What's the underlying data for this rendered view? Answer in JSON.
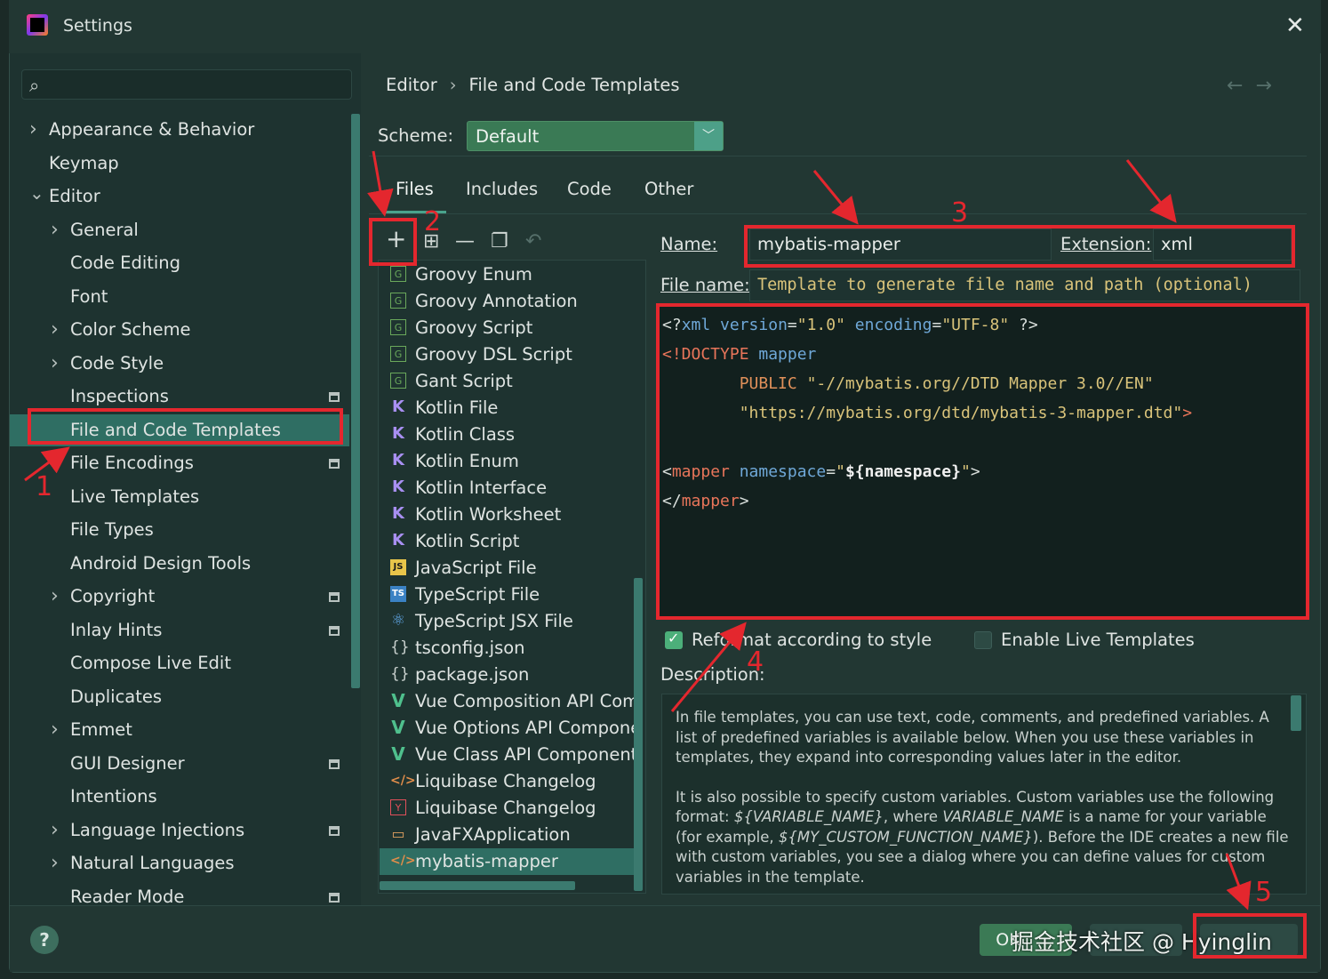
{
  "window": {
    "title": "Settings"
  },
  "search": {
    "placeholder": ""
  },
  "sidebar": {
    "items": [
      {
        "label": "Appearance & Behavior",
        "chev": ">",
        "level": 0
      },
      {
        "label": "Keymap",
        "chev": "",
        "level": 0
      },
      {
        "label": "Editor",
        "chev": "v",
        "level": 0
      },
      {
        "label": "General",
        "chev": ">",
        "level": 1
      },
      {
        "label": "Code Editing",
        "chev": "",
        "level": 1
      },
      {
        "label": "Font",
        "chev": "",
        "level": 1
      },
      {
        "label": "Color Scheme",
        "chev": ">",
        "level": 1
      },
      {
        "label": "Code Style",
        "chev": ">",
        "level": 1
      },
      {
        "label": "Inspections",
        "chev": "",
        "level": 1,
        "pin": true
      },
      {
        "label": "File and Code Templates",
        "chev": "",
        "level": 1,
        "selected": true
      },
      {
        "label": "File Encodings",
        "chev": "",
        "level": 1,
        "pin": true
      },
      {
        "label": "Live Templates",
        "chev": "",
        "level": 1
      },
      {
        "label": "File Types",
        "chev": "",
        "level": 1
      },
      {
        "label": "Android Design Tools",
        "chev": "",
        "level": 1
      },
      {
        "label": "Copyright",
        "chev": ">",
        "level": 1,
        "pin": true
      },
      {
        "label": "Inlay Hints",
        "chev": "",
        "level": 1,
        "pin": true
      },
      {
        "label": "Compose Live Edit",
        "chev": "",
        "level": 1
      },
      {
        "label": "Duplicates",
        "chev": "",
        "level": 1
      },
      {
        "label": "Emmet",
        "chev": ">",
        "level": 1
      },
      {
        "label": "GUI Designer",
        "chev": "",
        "level": 1,
        "pin": true
      },
      {
        "label": "Intentions",
        "chev": "",
        "level": 1
      },
      {
        "label": "Language Injections",
        "chev": ">",
        "level": 1,
        "pin": true
      },
      {
        "label": "Natural Languages",
        "chev": ">",
        "level": 1
      },
      {
        "label": "Reader Mode",
        "chev": "",
        "level": 1,
        "pin": true
      }
    ]
  },
  "breadcrumb": {
    "parent": "Editor",
    "current": "File and Code Templates"
  },
  "scheme": {
    "label": "Scheme:",
    "value": "Default"
  },
  "tabs": [
    "Files",
    "Includes",
    "Code",
    "Other"
  ],
  "templates": [
    {
      "label": "Groovy Enum",
      "icon": "groovy-icon",
      "glyph": "G",
      "cls": "g"
    },
    {
      "label": "Groovy Annotation",
      "icon": "groovy-icon",
      "glyph": "G",
      "cls": "g"
    },
    {
      "label": "Groovy Script",
      "icon": "groovy-icon",
      "glyph": "G",
      "cls": "g"
    },
    {
      "label": "Groovy DSL Script",
      "icon": "groovy-icon",
      "glyph": "G",
      "cls": "g"
    },
    {
      "label": "Gant Script",
      "icon": "groovy-icon",
      "glyph": "G",
      "cls": "g"
    },
    {
      "label": "Kotlin File",
      "icon": "kotlin-icon",
      "glyph": "K",
      "cls": "k"
    },
    {
      "label": "Kotlin Class",
      "icon": "kotlin-icon",
      "glyph": "K",
      "cls": "k"
    },
    {
      "label": "Kotlin Enum",
      "icon": "kotlin-icon",
      "glyph": "K",
      "cls": "k"
    },
    {
      "label": "Kotlin Interface",
      "icon": "kotlin-icon",
      "glyph": "K",
      "cls": "k"
    },
    {
      "label": "Kotlin Worksheet",
      "icon": "kotlin-icon",
      "glyph": "K",
      "cls": "k"
    },
    {
      "label": "Kotlin Script",
      "icon": "kotlin-icon",
      "glyph": "K",
      "cls": "k"
    },
    {
      "label": "JavaScript File",
      "icon": "javascript-icon",
      "glyph": "JS",
      "cls": "js"
    },
    {
      "label": "TypeScript File",
      "icon": "typescript-icon",
      "glyph": "TS",
      "cls": "ts"
    },
    {
      "label": "TypeScript JSX File",
      "icon": "react-icon",
      "glyph": "⚛",
      "cls": "jsx"
    },
    {
      "label": "tsconfig.json",
      "icon": "json-icon",
      "glyph": "{}",
      "cls": "br"
    },
    {
      "label": "package.json",
      "icon": "json-icon",
      "glyph": "{}",
      "cls": "br"
    },
    {
      "label": "Vue Composition API Comp",
      "icon": "vue-icon",
      "glyph": "V",
      "cls": "v"
    },
    {
      "label": "Vue Options API Componer",
      "icon": "vue-icon",
      "glyph": "V",
      "cls": "v"
    },
    {
      "label": "Vue Class API Component",
      "icon": "vue-icon",
      "glyph": "V",
      "cls": "v"
    },
    {
      "label": "Liquibase Changelog",
      "icon": "xml-icon",
      "glyph": "</>",
      "cls": "x"
    },
    {
      "label": "Liquibase Changelog",
      "icon": "yaml-icon",
      "glyph": "Y",
      "cls": "y"
    },
    {
      "label": "JavaFXApplication",
      "icon": "javafx-icon",
      "glyph": "▭",
      "cls": "fx"
    },
    {
      "label": "mybatis-mapper",
      "icon": "xml-icon",
      "glyph": "</>",
      "cls": "x",
      "selected": true
    }
  ],
  "form": {
    "name_label": "Name:",
    "name_value": "mybatis-mapper",
    "extension_label": "Extension:",
    "extension_value": "xml",
    "filename_label": "File name:",
    "filename_placeholder": "Template to generate file name and path (optional)"
  },
  "code": {
    "line1": [
      [
        "c-plain",
        "<?"
      ],
      [
        "c-attr",
        "xml "
      ],
      [
        "c-attr",
        "version"
      ],
      [
        "c-plain",
        "="
      ],
      [
        "c-str",
        "\"1.0\" "
      ],
      [
        "c-attr",
        "encoding"
      ],
      [
        "c-plain",
        "="
      ],
      [
        "c-str",
        "\"UTF-8\""
      ],
      [
        "c-plain",
        " ?>"
      ]
    ],
    "line2": [
      [
        "c-tag",
        "<!DOCTYPE "
      ],
      [
        "c-attr",
        "mapper"
      ]
    ],
    "line3": [
      [
        "c-plain",
        "        "
      ],
      [
        "c-kw",
        "PUBLIC "
      ],
      [
        "c-str",
        "\"-//mybatis.org//DTD Mapper 3.0//EN\""
      ]
    ],
    "line4": [
      [
        "c-plain",
        "        "
      ],
      [
        "c-str",
        "\"https://mybatis.org/dtd/mybatis-3-mapper.dtd\""
      ],
      [
        "c-tag",
        ">"
      ]
    ],
    "line5": [],
    "line6": [
      [
        "c-plain",
        "<"
      ],
      [
        "c-tag",
        "mapper "
      ],
      [
        "c-attr",
        "namespace"
      ],
      [
        "c-plain",
        "="
      ],
      [
        "c-str",
        "\""
      ],
      [
        "c-var",
        "${namespace}"
      ],
      [
        "c-str",
        "\""
      ],
      [
        "c-plain",
        ">"
      ]
    ],
    "line7": [
      [
        "c-plain",
        "</"
      ],
      [
        "c-tag",
        "mapper"
      ],
      [
        "c-plain",
        ">"
      ]
    ]
  },
  "options": {
    "reformat_label": "Reformat according to style",
    "reformat_checked": true,
    "live_label": "Enable Live Templates",
    "live_checked": false
  },
  "description": {
    "label": "Description:",
    "p1": "In file templates, you can use text, code, comments, and predefined variables. A list of predefined variables is available below. When you use these variables in templates, they expand into corresponding values later in the editor.",
    "p2_a": "It is also possible to specify custom variables. Custom variables use the following format: ",
    "p2_var1": "${VARIABLE_NAME}",
    "p2_b": ", where ",
    "p2_var2": "VARIABLE_NAME",
    "p2_c": " is a name for your variable (for example, ",
    "p2_var3": "${MY_CUSTOM_FUNCTION_NAME}",
    "p2_d": "). Before the IDE creates a new file with custom variables, you see a dialog where you can define values for custom variables in the template."
  },
  "footer": {
    "ok_label": "OK",
    "watermark": "掘金技术社区 @ Hyinglin"
  },
  "annotations": [
    "1",
    "2",
    "3",
    "4",
    "5"
  ],
  "colors": {
    "accent": "#2f6e63",
    "highlight_red": "#e4272e",
    "ok_button": "#3b7a55"
  }
}
